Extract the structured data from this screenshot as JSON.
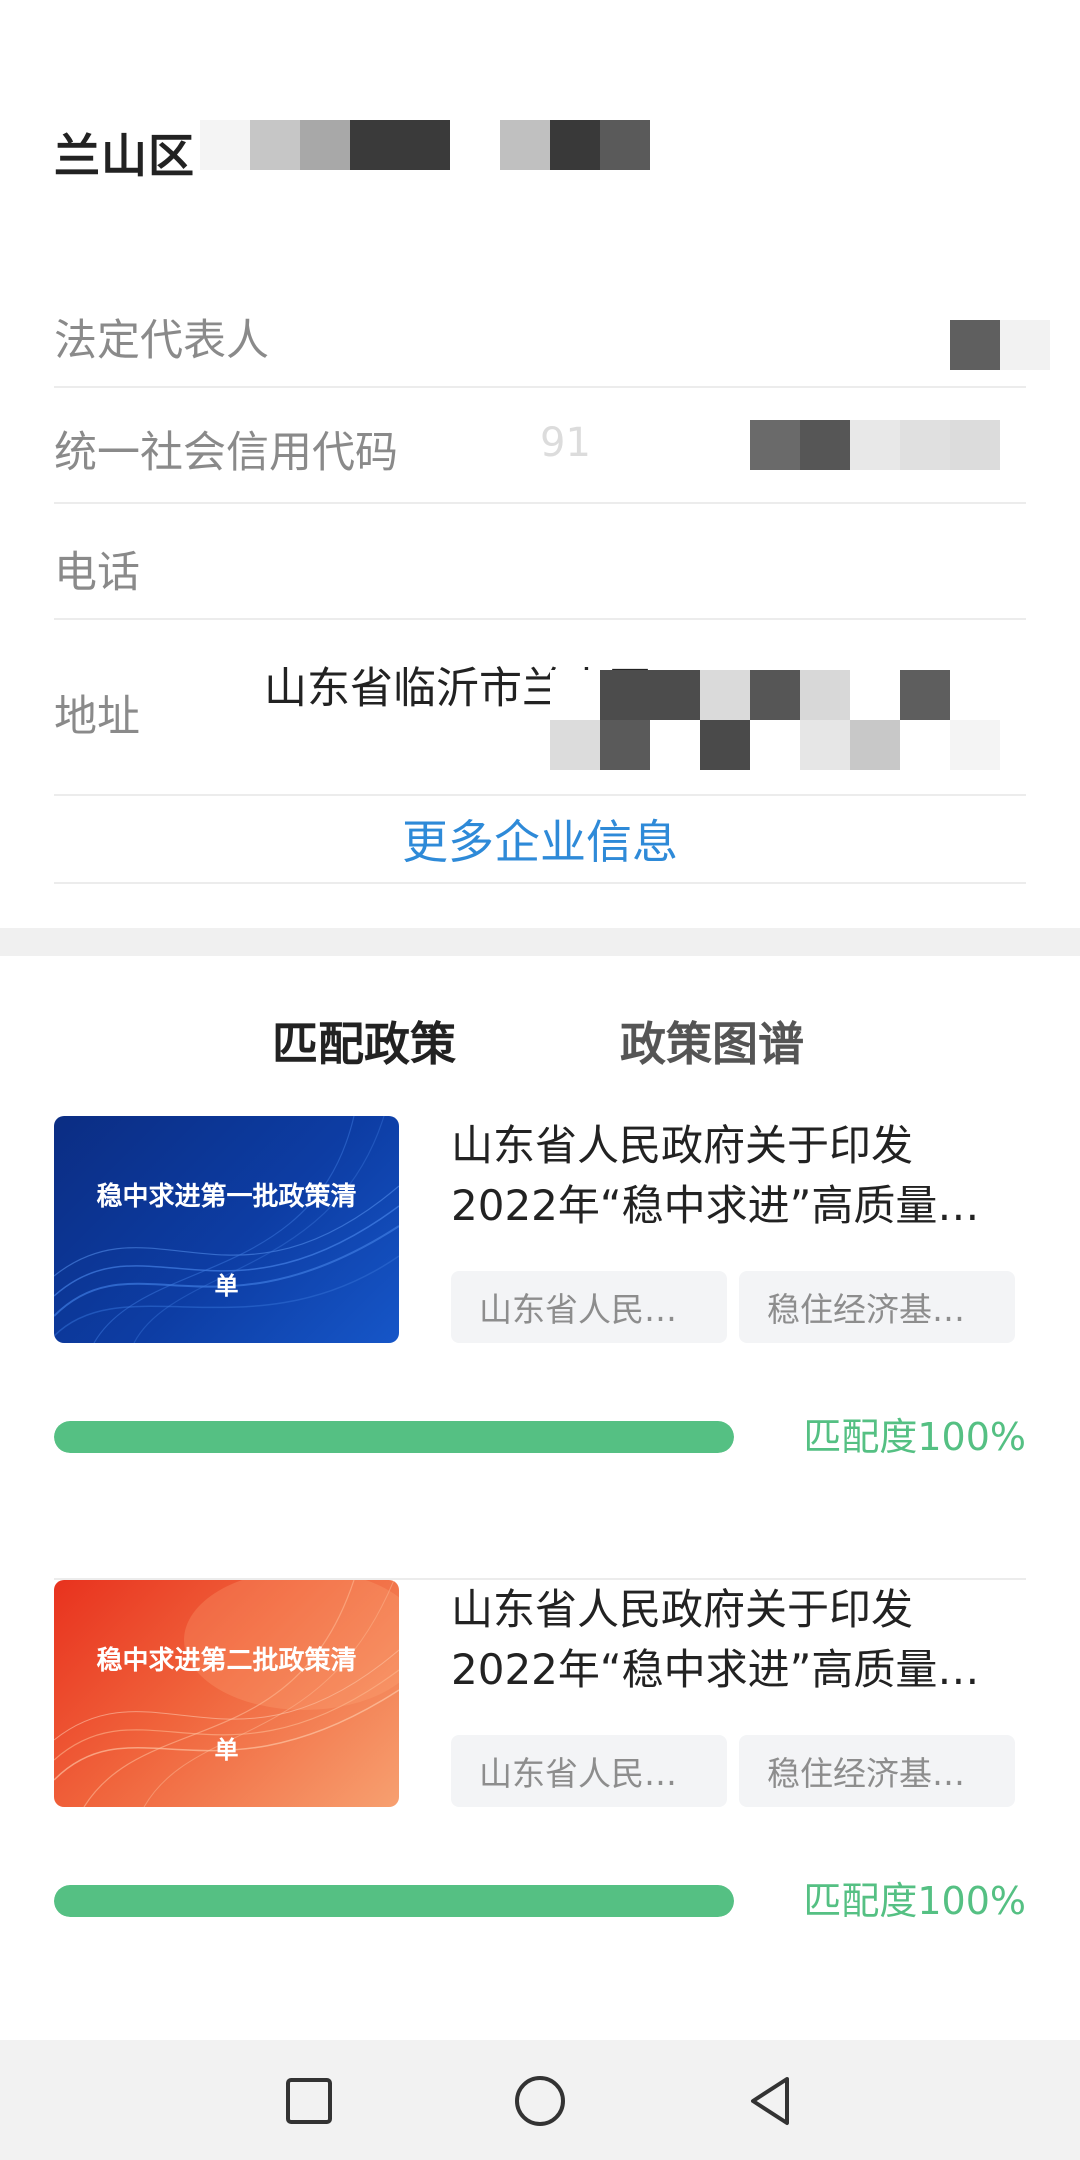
{
  "company": {
    "name_visible": "兰山区",
    "fields": [
      {
        "label": "法定代表人",
        "value": ""
      },
      {
        "label": "统一社会信用代码",
        "value": "91"
      },
      {
        "label": "电话",
        "value": ""
      },
      {
        "label": "地址",
        "value": "山东省临沂市兰山区"
      }
    ],
    "more_link": "更多企业信息"
  },
  "tabs": [
    {
      "label": "匹配政策",
      "active": true
    },
    {
      "label": "政策图谱",
      "active": false
    }
  ],
  "policies": [
    {
      "thumb_line1": "稳中求进第一批政策清",
      "thumb_line2": "单",
      "thumb_theme": "blue",
      "title_line1": "山东省人民政府关于印发",
      "title_line2": "2022年“稳中求进”高质量…",
      "tags": [
        "山东省人民…",
        "稳住经济基…"
      ],
      "match_label": "匹配度100%",
      "match_fraction": 1.0
    },
    {
      "thumb_line1": "稳中求进第二批政策清",
      "thumb_line2": "单",
      "thumb_theme": "orange",
      "title_line1": "山东省人民政府关于印发",
      "title_line2": "2022年“稳中求进”高质量…",
      "tags": [
        "山东省人民…",
        "稳住经济基…"
      ],
      "match_label": "匹配度100%",
      "match_fraction": 1.0
    }
  ],
  "navbar": {
    "buttons": [
      "recent-apps-icon",
      "home-icon",
      "back-icon"
    ]
  },
  "colors": {
    "accent_link": "#2e8ad8",
    "match_green": "#55c083",
    "thumb_blue": "#0a2f86",
    "thumb_orange": "#f07a4a"
  }
}
